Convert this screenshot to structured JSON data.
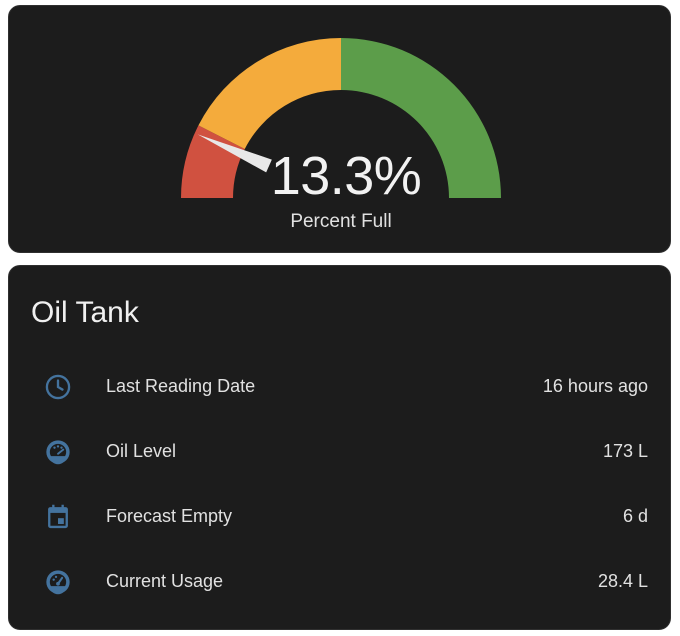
{
  "gauge": {
    "value_text": "13.3%",
    "value": 13.3,
    "min": 0,
    "max": 100,
    "label": "Percent Full",
    "severity": [
      {
        "from": 0,
        "to": 15,
        "color": "#d05140"
      },
      {
        "from": 15,
        "to": 50,
        "color": "#f4ab3c"
      },
      {
        "from": 50,
        "to": 100,
        "color": "#5c9d4a"
      }
    ],
    "needle_color": "#e8e8e8"
  },
  "entities_card": {
    "title": "Oil Tank",
    "icon_color": "#44739e",
    "rows": [
      {
        "icon": "clock-icon",
        "name": "Last Reading Date",
        "state": "16 hours ago"
      },
      {
        "icon": "gauge-icon",
        "name": "Oil Level",
        "state": "173 L"
      },
      {
        "icon": "calendar-icon",
        "name": "Forecast Empty",
        "state": "6 d"
      },
      {
        "icon": "speedometer-icon",
        "name": "Current Usage",
        "state": "28.4 L"
      }
    ]
  }
}
